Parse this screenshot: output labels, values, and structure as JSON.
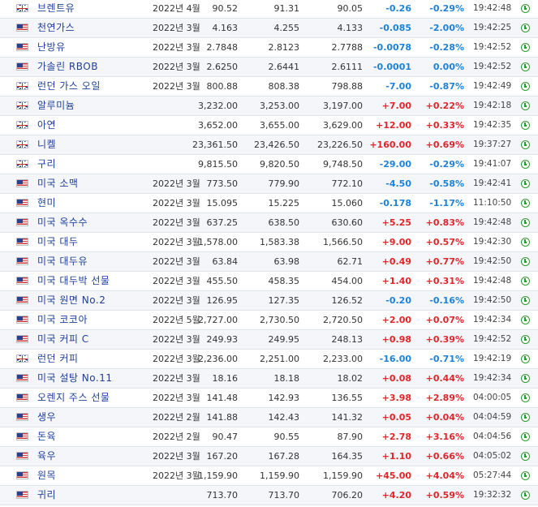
{
  "colors": {
    "up": "#e0262b",
    "down": "#1e82d8",
    "name": "#1f3f99"
  },
  "rows": [
    {
      "flag": "uk-flag-icon",
      "name": "브렌트유",
      "month": "2022년 4월",
      "last": "90.52",
      "high": "91.31",
      "low": "90.05",
      "change": "-0.26",
      "percent": "-0.29%",
      "time": "19:42:48"
    },
    {
      "flag": "us-flag-icon",
      "name": "천연가스",
      "month": "2022년 3월",
      "last": "4.163",
      "high": "4.255",
      "low": "4.133",
      "change": "-0.085",
      "percent": "-2.00%",
      "time": "19:42:25"
    },
    {
      "flag": "us-flag-icon",
      "name": "난방유",
      "month": "2022년 3월",
      "last": "2.7848",
      "high": "2.8123",
      "low": "2.7788",
      "change": "-0.0078",
      "percent": "-0.28%",
      "time": "19:42:52"
    },
    {
      "flag": "us-flag-icon",
      "name": "가솔린 RBOB",
      "month": "2022년 3월",
      "last": "2.6250",
      "high": "2.6441",
      "low": "2.6111",
      "change": "-0.0001",
      "percent": "0.00%",
      "time": "19:42:52"
    },
    {
      "flag": "uk-flag-icon",
      "name": "런던 가스 오일",
      "month": "2022년 3월",
      "last": "800.88",
      "high": "808.38",
      "low": "798.88",
      "change": "-7.00",
      "percent": "-0.87%",
      "time": "19:42:49"
    },
    {
      "flag": "uk-flag-icon",
      "name": "알루미늄",
      "month": "",
      "last": "3,232.00",
      "high": "3,253.00",
      "low": "3,197.00",
      "change": "+7.00",
      "percent": "+0.22%",
      "time": "19:42:18"
    },
    {
      "flag": "uk-flag-icon",
      "name": "아연",
      "month": "",
      "last": "3,652.00",
      "high": "3,655.00",
      "low": "3,629.00",
      "change": "+12.00",
      "percent": "+0.33%",
      "time": "19:42:35"
    },
    {
      "flag": "uk-flag-icon",
      "name": "니켈",
      "month": "",
      "last": "23,361.50",
      "high": "23,426.50",
      "low": "23,226.50",
      "change": "+160.00",
      "percent": "+0.69%",
      "time": "19:37:27"
    },
    {
      "flag": "uk-flag-icon",
      "name": "구리",
      "month": "",
      "last": "9,815.50",
      "high": "9,820.50",
      "low": "9,748.50",
      "change": "-29.00",
      "percent": "-0.29%",
      "time": "19:41:07"
    },
    {
      "flag": "us-flag-icon",
      "name": "미국 소맥",
      "month": "2022년 3월",
      "last": "773.50",
      "high": "779.90",
      "low": "772.10",
      "change": "-4.50",
      "percent": "-0.58%",
      "time": "19:42:41"
    },
    {
      "flag": "us-flag-icon",
      "name": "현미",
      "month": "2022년 3월",
      "last": "15.095",
      "high": "15.225",
      "low": "15.060",
      "change": "-0.178",
      "percent": "-1.17%",
      "time": "11:10:50"
    },
    {
      "flag": "us-flag-icon",
      "name": "미국 옥수수",
      "month": "2022년 3월",
      "last": "637.25",
      "high": "638.50",
      "low": "630.60",
      "change": "+5.25",
      "percent": "+0.83%",
      "time": "19:42:48"
    },
    {
      "flag": "us-flag-icon",
      "name": "미국 대두",
      "month": "2022년 3월",
      "last": "1,578.00",
      "high": "1,583.38",
      "low": "1,566.50",
      "change": "+9.00",
      "percent": "+0.57%",
      "time": "19:42:30"
    },
    {
      "flag": "us-flag-icon",
      "name": "미국 대두유",
      "month": "2022년 3월",
      "last": "63.84",
      "high": "63.98",
      "low": "62.71",
      "change": "+0.49",
      "percent": "+0.77%",
      "time": "19:42:50"
    },
    {
      "flag": "us-flag-icon",
      "name": "미국 대두박 선물",
      "month": "2022년 3월",
      "last": "455.50",
      "high": "458.35",
      "low": "454.00",
      "change": "+1.40",
      "percent": "+0.31%",
      "time": "19:42:48"
    },
    {
      "flag": "us-flag-icon",
      "name": "미국 원면 No.2",
      "month": "2022년 3월",
      "last": "126.95",
      "high": "127.35",
      "low": "126.52",
      "change": "-0.20",
      "percent": "-0.16%",
      "time": "19:42:50"
    },
    {
      "flag": "us-flag-icon",
      "name": "미국 코코아",
      "month": "2022년 5월",
      "last": "2,727.00",
      "high": "2,730.50",
      "low": "2,720.50",
      "change": "+2.00",
      "percent": "+0.07%",
      "time": "19:42:34"
    },
    {
      "flag": "us-flag-icon",
      "name": "미국 커피 C",
      "month": "2022년 3월",
      "last": "249.93",
      "high": "249.95",
      "low": "248.13",
      "change": "+0.98",
      "percent": "+0.39%",
      "time": "19:42:52"
    },
    {
      "flag": "uk-flag-icon",
      "name": "런던 커피",
      "month": "2022년 3월",
      "last": "2,236.00",
      "high": "2,251.00",
      "low": "2,233.00",
      "change": "-16.00",
      "percent": "-0.71%",
      "time": "19:42:19"
    },
    {
      "flag": "us-flag-icon",
      "name": "미국 설탕 No.11",
      "month": "2022년 3월",
      "last": "18.16",
      "high": "18.18",
      "low": "18.02",
      "change": "+0.08",
      "percent": "+0.44%",
      "time": "19:42:34"
    },
    {
      "flag": "us-flag-icon",
      "name": "오렌지 주스 선물",
      "month": "2022년 3월",
      "last": "141.48",
      "high": "142.93",
      "low": "136.55",
      "change": "+3.98",
      "percent": "+2.89%",
      "time": "04:00:05"
    },
    {
      "flag": "us-flag-icon",
      "name": "생우",
      "month": "2022년 2월",
      "last": "141.88",
      "high": "142.43",
      "low": "141.32",
      "change": "+0.05",
      "percent": "+0.04%",
      "time": "04:04:59"
    },
    {
      "flag": "us-flag-icon",
      "name": "돈육",
      "month": "2022년 2월",
      "last": "90.47",
      "high": "90.55",
      "low": "87.90",
      "change": "+2.78",
      "percent": "+3.16%",
      "time": "04:04:56"
    },
    {
      "flag": "us-flag-icon",
      "name": "육우",
      "month": "2022년 3월",
      "last": "167.20",
      "high": "167.28",
      "low": "164.35",
      "change": "+1.10",
      "percent": "+0.66%",
      "time": "04:05:02"
    },
    {
      "flag": "us-flag-icon",
      "name": "원목",
      "month": "2022년 3월",
      "last": "1,159.90",
      "high": "1,159.90",
      "low": "1,159.90",
      "change": "+45.00",
      "percent": "+4.04%",
      "time": "05:27:44"
    },
    {
      "flag": "us-flag-icon",
      "name": "귀리",
      "month": "",
      "last": "713.70",
      "high": "713.70",
      "low": "706.20",
      "change": "+4.20",
      "percent": "+0.59%",
      "time": "19:32:32"
    }
  ]
}
